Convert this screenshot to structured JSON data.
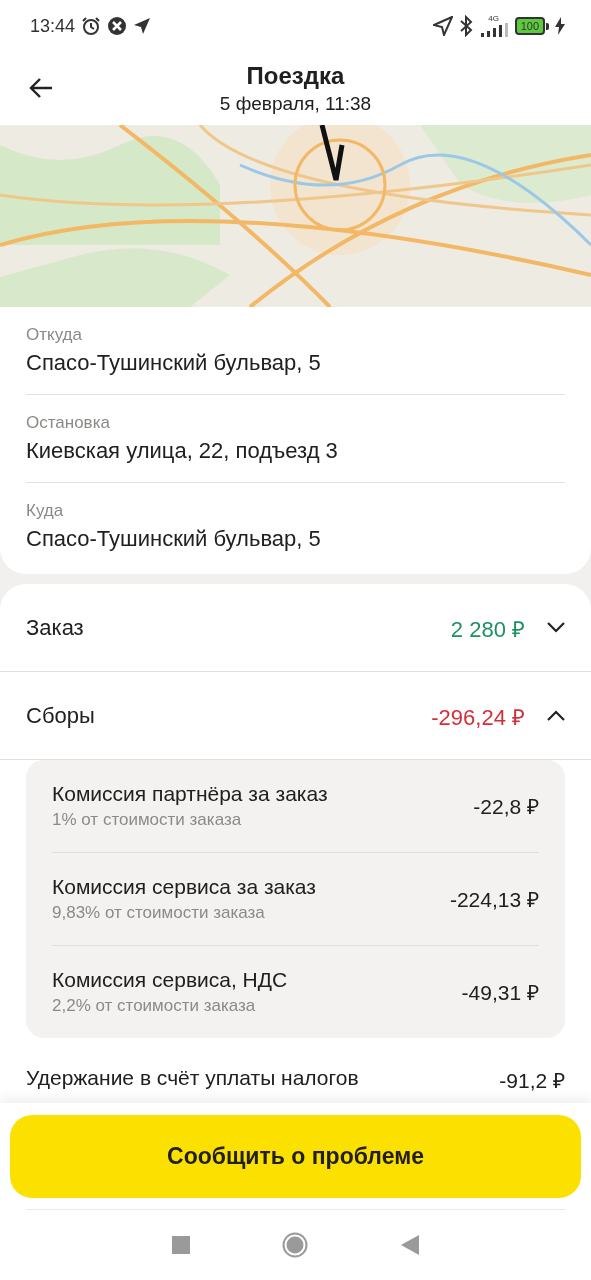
{
  "status_bar": {
    "time": "13:44",
    "network": "4G",
    "battery": "100"
  },
  "header": {
    "title": "Поездка",
    "subtitle": "5 февраля, 11:38"
  },
  "route": [
    {
      "label": "Откуда",
      "address": "Спасо-Тушинский бульвар, 5"
    },
    {
      "label": "Остановка",
      "address": "Киевская улица, 22, подъезд 3"
    },
    {
      "label": "Куда",
      "address": "Спасо-Тушинский бульвар, 5"
    }
  ],
  "sections": [
    {
      "title": "Заказ",
      "amount": "2 280 ₽",
      "color": "#1f9160",
      "expanded": false
    },
    {
      "title": "Сборы",
      "amount": "-296,24 ₽",
      "color": "#d1303a",
      "expanded": true,
      "items": [
        {
          "name": "Комиссия партнёра за заказ",
          "note": "1% от стоимости заказа",
          "amount": "-22,8 ₽"
        },
        {
          "name": "Комиссия сервиса за заказ",
          "note": "9,83% от стоимости заказа",
          "amount": "-224,13 ₽"
        },
        {
          "name": "Комиссия сервиса, НДС",
          "note": "2,2% от стоимости заказа",
          "amount": "-49,31 ₽"
        }
      ]
    }
  ],
  "tax_row": {
    "label": "Удержание в счёт уплаты налогов",
    "amount": "-91,2 ₽"
  },
  "report_button": {
    "label": "Сообщить о проблеме"
  }
}
